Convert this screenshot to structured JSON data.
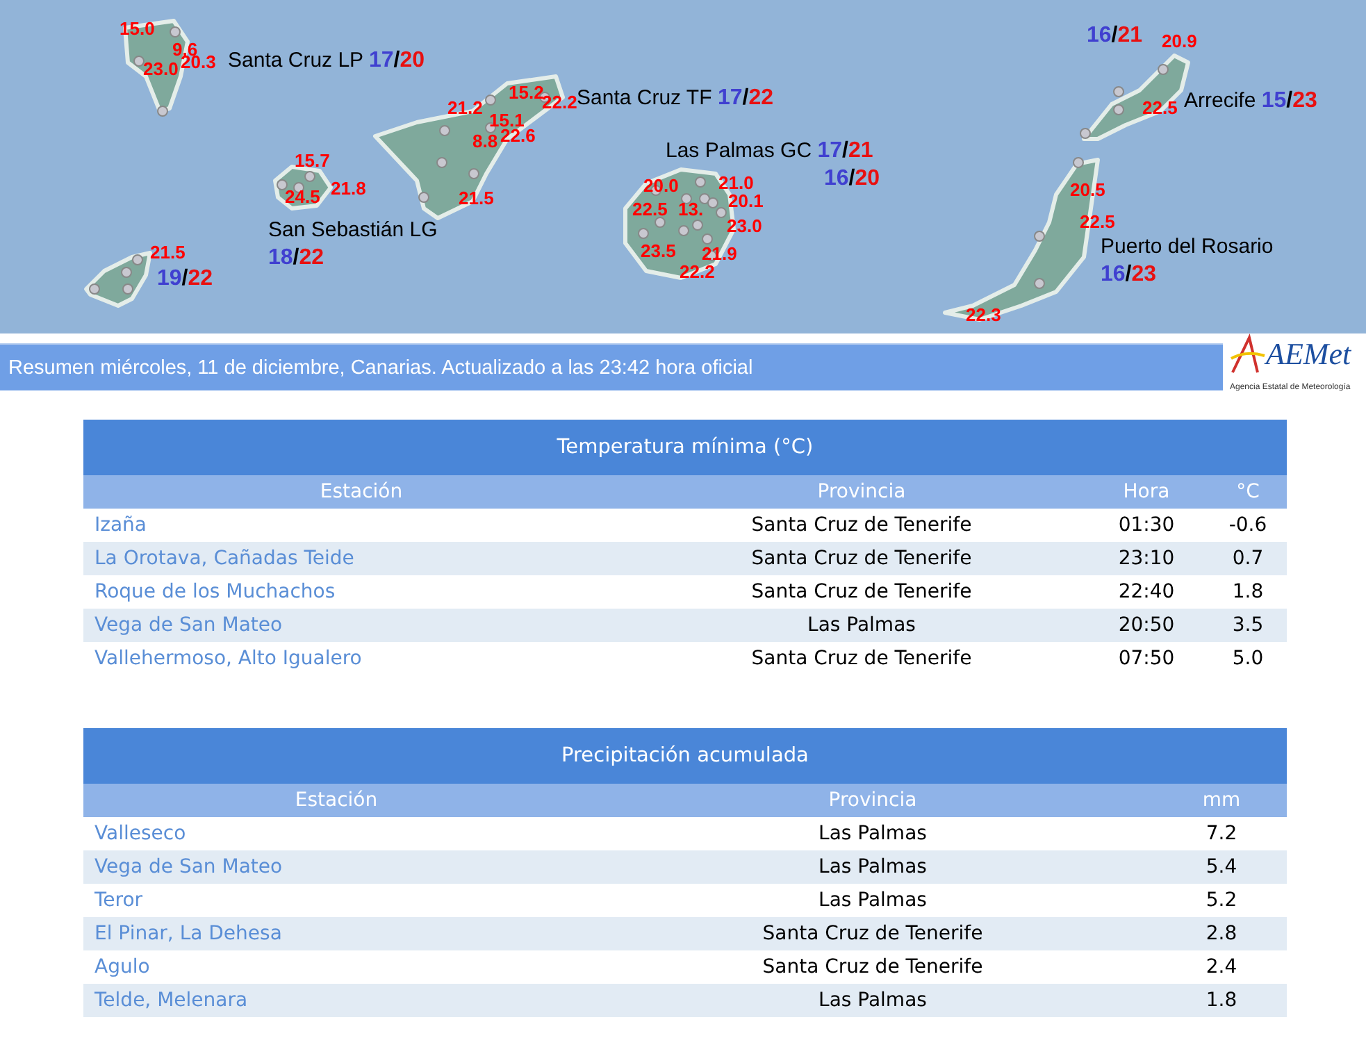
{
  "map": {
    "temperatures": [
      "15.0",
      "9.6",
      "23.0",
      "20.3",
      "21.2",
      "15.1",
      "15.2",
      "22.2",
      "8.8",
      "22.6",
      "21.5",
      "15.7",
      "24.5",
      "21.8",
      "21.5",
      "20.0",
      "21.0",
      "20.1",
      "22.5",
      "13.",
      "23.0",
      "23.5",
      "21.9",
      "22.2",
      "20.9",
      "22.5",
      "20.5",
      "22.5",
      "22.3"
    ],
    "cities": [
      {
        "name": "Santa Cruz LP",
        "min": "17",
        "separator": "/",
        "max": "20"
      },
      {
        "name": "Santa Cruz TF",
        "min": "17",
        "separator": "/",
        "max": "22"
      },
      {
        "name": "Las Palmas GC",
        "min": "17",
        "separator": "/",
        "max": "21"
      },
      {
        "min": "16",
        "separator": "/",
        "max": "20"
      },
      {
        "name": "San Sebastián LG",
        "min": "18",
        "separator": "/",
        "max": "22"
      },
      {
        "min": "19",
        "separator": "/",
        "max": "22"
      },
      {
        "min": "16",
        "separator": "/",
        "max": "21"
      },
      {
        "name": "Arrecife",
        "min": "15",
        "separator": "/",
        "max": "23"
      },
      {
        "name": "Puerto del Rosario",
        "min": "16",
        "separator": "/",
        "max": "23"
      }
    ]
  },
  "summary": "Resumen miércoles, 11 de diciembre, Canarias. Actualizado a las 23:42 hora oficial",
  "logo": {
    "wordmark": "AEMet",
    "tagline": "Agencia Estatal de Meteorología"
  },
  "tables": [
    {
      "title": "Temperatura mínima (°C)",
      "columns": [
        "Estación",
        "Provincia",
        "Hora",
        "°C"
      ],
      "rows": [
        [
          "Izaña",
          "Santa Cruz de Tenerife",
          "01:30",
          "-0.6"
        ],
        [
          "La Orotava, Cañadas Teide",
          "Santa Cruz de Tenerife",
          "23:10",
          "0.7"
        ],
        [
          "Roque de los Muchachos",
          "Santa Cruz de Tenerife",
          "22:40",
          "1.8"
        ],
        [
          "Vega de San Mateo",
          "Las Palmas",
          "20:50",
          "3.5"
        ],
        [
          "Vallehermoso, Alto Igualero",
          "Santa Cruz de Tenerife",
          "07:50",
          "5.0"
        ]
      ]
    },
    {
      "title": "Precipitación acumulada",
      "columns": [
        "Estación",
        "Provincia",
        "mm"
      ],
      "rows": [
        [
          "Valleseco",
          "Las Palmas",
          "7.2"
        ],
        [
          "Vega de San Mateo",
          "Las Palmas",
          "5.4"
        ],
        [
          "Teror",
          "Las Palmas",
          "5.2"
        ],
        [
          "El Pinar, La Dehesa",
          "Santa Cruz de Tenerife",
          "2.8"
        ],
        [
          "Agulo",
          "Santa Cruz de Tenerife",
          "2.4"
        ],
        [
          "Telde, Melenara",
          "Las Palmas",
          "1.8"
        ]
      ]
    }
  ]
}
